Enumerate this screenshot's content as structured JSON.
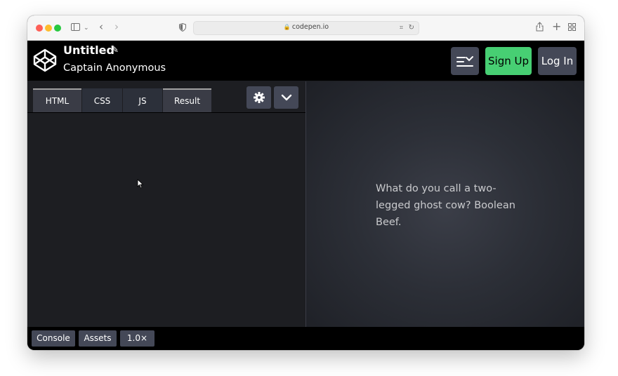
{
  "browser": {
    "url": "codepen.io",
    "controls": {
      "sidebar_icon": "sidebar-icon",
      "back_icon": "chevron-left-icon",
      "forward_icon": "chevron-right-icon",
      "shield_icon": "shield-icon",
      "share_icon": "share-icon",
      "new_tab_icon": "plus-icon",
      "tab_overview_icon": "grid-icon"
    }
  },
  "header": {
    "title": "Untitled",
    "author": "Captain Anonymous",
    "signup_label": "Sign Up",
    "login_label": "Log In"
  },
  "editor": {
    "tabs": [
      {
        "label": "HTML"
      },
      {
        "label": "CSS"
      },
      {
        "label": "JS"
      },
      {
        "label": "Result"
      }
    ]
  },
  "result": {
    "text": "What do you call a two-legged ghost cow? Boolean Beef."
  },
  "footer": {
    "console_label": "Console",
    "assets_label": "Assets",
    "zoom_label": "1.0×"
  },
  "colors": {
    "brand_green": "#47cf73",
    "button_gray": "#444857",
    "header_bg": "#000000",
    "editor_bg": "#1d1e22"
  }
}
